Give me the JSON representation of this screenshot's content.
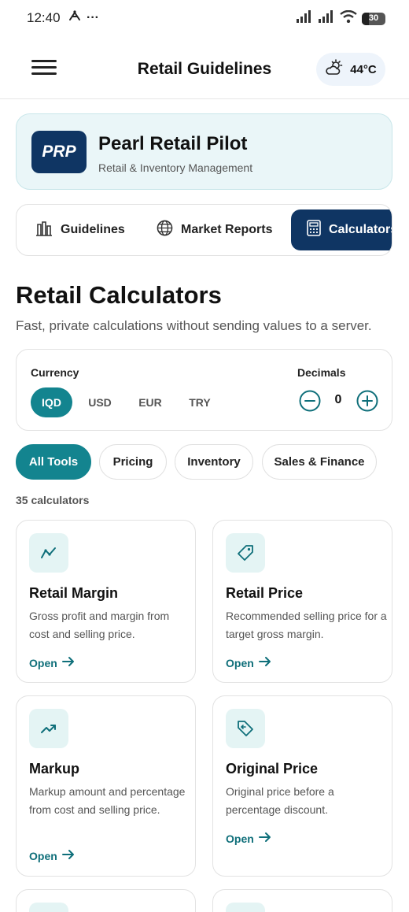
{
  "status_bar": {
    "time": "12:40",
    "dots": "···",
    "battery": "30",
    "battery_level": 0.3
  },
  "app_bar": {
    "title": "Retail Guidelines",
    "temperature": "44°C",
    "weather_icon": "partly-cloudy-icon",
    "menu_icon": "hamburger-menu-icon"
  },
  "brand": {
    "logo_text": "PRP",
    "name": "Pearl Retail Pilot",
    "tagline": "Retail & Inventory Management"
  },
  "tabs": [
    {
      "label": "Guidelines",
      "icon": "guidelines-icon"
    },
    {
      "label": "Market Reports",
      "icon": "globe-icon"
    },
    {
      "label": "Calculators",
      "icon": "calculator-icon",
      "active": true
    }
  ],
  "page": {
    "title": "Retail Calculators",
    "subtitle": "Fast, private calculations without sending values to a server."
  },
  "settings": {
    "currency_label": "Currency",
    "currencies": [
      "IQD",
      "USD",
      "EUR",
      "TRY"
    ],
    "selected_currency": "IQD",
    "decimals_label": "Decimals",
    "decimals_value": "0"
  },
  "filters": [
    "All Tools",
    "Pricing",
    "Inventory",
    "Sales & Finance"
  ],
  "active_filter": "All Tools",
  "calculator_count": "35 calculators",
  "calculators": [
    {
      "title": "Retail Margin",
      "description": "Gross profit and margin from cost and selling price.",
      "action": "Open",
      "icon": "trend-line-icon"
    },
    {
      "title": "Retail Price",
      "description": "Recommended selling price for a target gross margin.",
      "action": "Open",
      "icon": "price-tag-icon"
    },
    {
      "title": "Markup",
      "description": "Markup amount and percentage from cost and selling price.",
      "action": "Open",
      "icon": "trend-up-icon"
    },
    {
      "title": "Original Price",
      "description": "Original price before a percentage discount.",
      "action": "Open",
      "icon": "reverse-tag-icon"
    }
  ],
  "colors": {
    "primary_navy": "#0f3563",
    "accent_teal": "#13848f",
    "brand_card_bg": "#eaf6f8",
    "icon_bg": "#e4f4f4"
  }
}
